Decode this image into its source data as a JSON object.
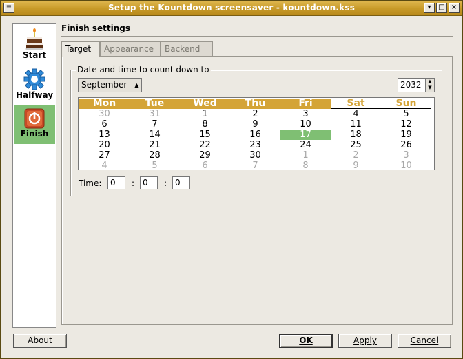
{
  "window": {
    "title": "Setup the Kountdown screensaver - kountdown.kss",
    "controls": [
      "menu-icon",
      "minimize-icon",
      "close-icon"
    ]
  },
  "sidebar": {
    "items": [
      {
        "label": "Start",
        "icon": "cake-icon",
        "active": false
      },
      {
        "label": "Halfway",
        "icon": "gear-icon",
        "active": false
      },
      {
        "label": "Finish",
        "icon": "power-icon",
        "active": true
      }
    ]
  },
  "main": {
    "title": "Finish settings",
    "tabs": [
      {
        "label": "Target",
        "active": true
      },
      {
        "label": "Appearance",
        "active": false
      },
      {
        "label": "Backend",
        "active": false
      }
    ],
    "group_label": "Date and time to count down to",
    "month": "September",
    "year": "2032",
    "calendar": {
      "weekdays": [
        "Mon",
        "Tue",
        "Wed",
        "Thu",
        "Fri",
        "Sat",
        "Sun"
      ],
      "weeks": [
        [
          "30",
          "31",
          "1",
          "2",
          "3",
          "4",
          "5"
        ],
        [
          "6",
          "7",
          "8",
          "9",
          "10",
          "11",
          "12"
        ],
        [
          "13",
          "14",
          "15",
          "16",
          "17",
          "18",
          "19"
        ],
        [
          "20",
          "21",
          "22",
          "23",
          "24",
          "25",
          "26"
        ],
        [
          "27",
          "28",
          "29",
          "30",
          "1",
          "2",
          "3"
        ],
        [
          "4",
          "5",
          "6",
          "7",
          "8",
          "9",
          "10"
        ]
      ],
      "selected": "17"
    },
    "time": {
      "label": "Time:",
      "hours": "0",
      "minutes": "0",
      "seconds": "0",
      "separator": ":"
    }
  },
  "buttons": {
    "about": "About",
    "ok": "OK",
    "apply": "Apply",
    "cancel": "Cancel"
  },
  "colors": {
    "title_bar": "#c79a28",
    "weekday_header": "#d4a437",
    "selected_day": "#7fbf73",
    "active_sidebar": "#7fbf73"
  }
}
